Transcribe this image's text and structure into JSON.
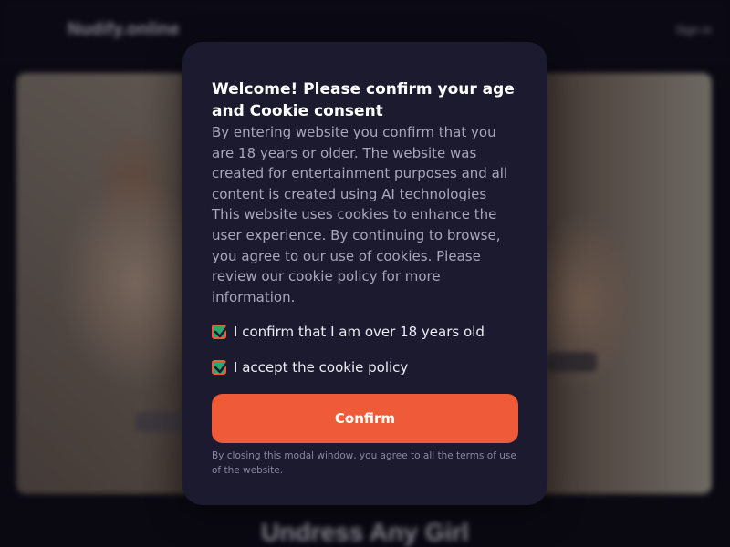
{
  "background_page": {
    "logo_text": "Nudify.online",
    "login_label": "Sign in",
    "headline": "Undress Any Girl"
  },
  "modal": {
    "title": "Welcome! Please confirm your age and Cookie consent",
    "body": "By entering website you confirm that you are 18 years or older. The website was created for entertainment purposes and all content is created using AI technologies This website uses cookies to enhance the user experience. By continuing to browse, you agree to our use of cookies. Please review our cookie policy for more information.",
    "age_checkbox": {
      "label": "I confirm that I am over 18 years old",
      "checked": true
    },
    "cookie_checkbox": {
      "label": "I accept the cookie policy",
      "checked": true
    },
    "confirm_label": "Confirm",
    "footnote": "By closing this modal window, you agree to all the terms of use of the website."
  },
  "colors": {
    "modal_bg": "#1c1a2e",
    "accent": "#ef5a38",
    "check_fill": "#2ea76d"
  },
  "icons": {
    "checkbox_checked": "checkmark-icon"
  }
}
